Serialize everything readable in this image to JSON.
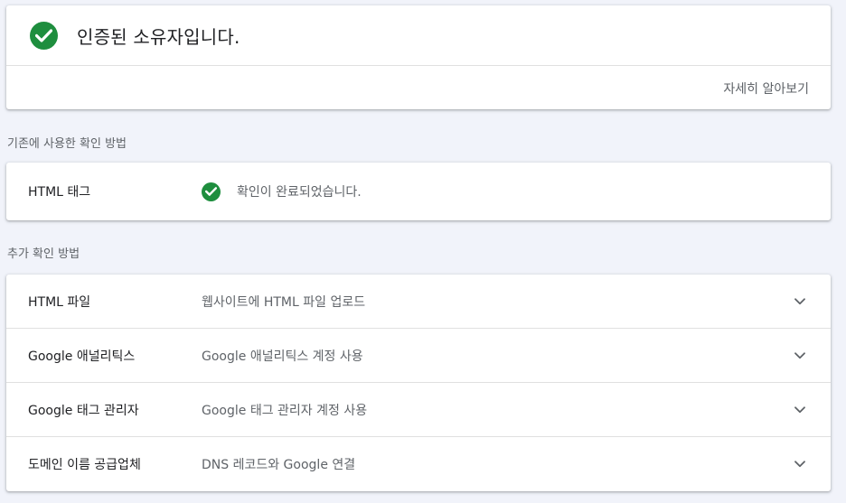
{
  "colors": {
    "success_green": "#1e8e3e",
    "background": "#f1f3fa",
    "secondary_text": "#5f6368"
  },
  "verified": {
    "icon": "check-circle-icon",
    "title": "인증된 소유자입니다.",
    "learn_more": "자세히 알아보기"
  },
  "previous_method": {
    "section_label": "기존에 사용한 확인 방법",
    "name": "HTML 태그",
    "status_icon": "check-circle-icon",
    "status_text": "확인이 완료되었습니다."
  },
  "additional_methods": {
    "section_label": "추가 확인 방법",
    "items": [
      {
        "name": "HTML 파일",
        "description": "웹사이트에 HTML 파일 업로드",
        "icon": "chevron-down-icon"
      },
      {
        "name": "Google 애널리틱스",
        "description": "Google 애널리틱스 계정 사용",
        "icon": "chevron-down-icon"
      },
      {
        "name": "Google 태그 관리자",
        "description": "Google 태그 관리자 계정 사용",
        "icon": "chevron-down-icon"
      },
      {
        "name": "도메인 이름 공급업체",
        "description": "DNS 레코드와 Google 연결",
        "icon": "chevron-down-icon"
      }
    ]
  }
}
